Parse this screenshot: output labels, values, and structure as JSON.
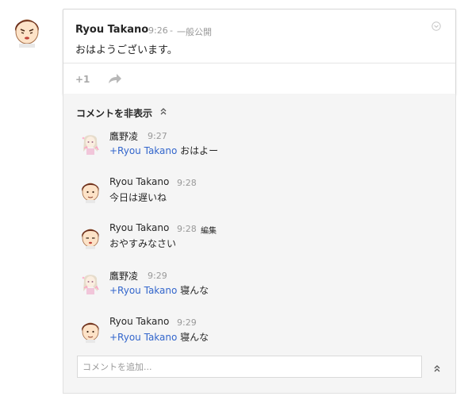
{
  "post": {
    "author": "Ryou Takano",
    "time": "9:26",
    "separator": "-",
    "visibility": "一般公開",
    "body": "おはようございます。",
    "plusone_label": "+1",
    "menu_icon": "chevron-down-circle-icon",
    "share_icon": "share-arrow-icon"
  },
  "comments": {
    "toggle_label": "コメントを非表示",
    "toggle_icon": "double-chevron-up-icon",
    "items": [
      {
        "author": "鷹野凌",
        "time": "9:27",
        "mention": "+Ryou Takano",
        "text": " おはよー",
        "avatar": "anime-girl-avatar"
      },
      {
        "author": "Ryou Takano",
        "time": "9:28",
        "mention": "",
        "text": "今日は遅いね",
        "avatar": "cartoon-boy-avatar"
      },
      {
        "author": "Ryou Takano",
        "time": "9:28",
        "edit": "編集",
        "mention": "",
        "text": "おやすみなさい",
        "avatar": "cartoon-boy-avatar"
      },
      {
        "author": "鷹野凌",
        "time": "9:29",
        "mention": "+Ryou Takano",
        "text": " 寝んな",
        "avatar": "anime-girl-avatar"
      },
      {
        "author": "Ryou Takano",
        "time": "9:29",
        "mention": "+Ryou Takano",
        "text": " 寝んな",
        "avatar": "cartoon-boy-avatar"
      }
    ],
    "add_placeholder": "コメントを追加...",
    "collapse_icon": "double-chevron-up-icon"
  },
  "colors": {
    "mention": "#3366cc",
    "timestamp": "#999999",
    "comments_bg": "#f5f5f5",
    "card_border": "#d8d8d8"
  }
}
